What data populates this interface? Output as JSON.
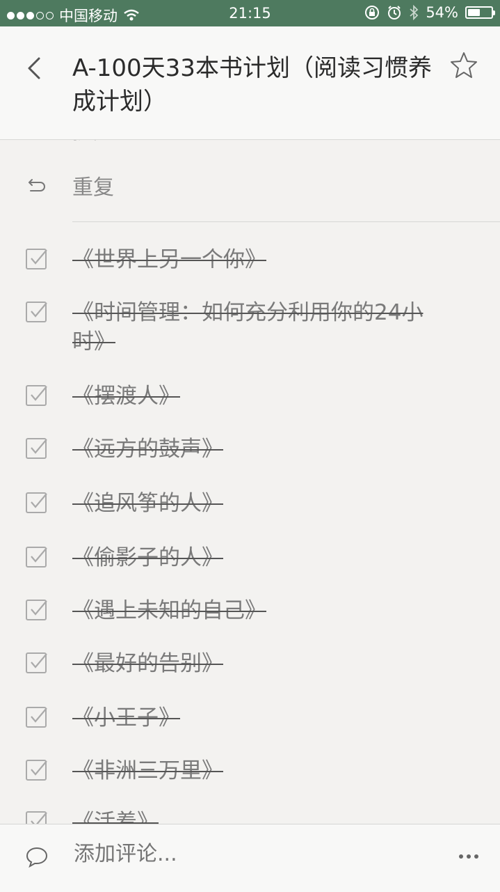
{
  "status_bar": {
    "carrier": "中国移动",
    "time": "21:15",
    "battery_percent": "54%",
    "battery_level": 0.54,
    "signal_bars": 3,
    "icons": [
      "wifi-icon",
      "rotation-lock-icon",
      "alarm-icon",
      "bluetooth-icon",
      "battery-icon"
    ]
  },
  "header": {
    "title": "A-100天33本书计划（阅读习惯养成计划）",
    "back_icon": "chevron-left-icon",
    "star_icon": "star-outline-icon"
  },
  "details": {
    "partial_label": "提醒",
    "repeat_label": "重复",
    "repeat_icon": "repeat-icon"
  },
  "checklist": [
    {
      "title": "《世界上另一个你》",
      "done": true
    },
    {
      "title": "《时间管理：如何充分利用你的24小时》",
      "done": true
    },
    {
      "title": "《摆渡人》",
      "done": true
    },
    {
      "title": "《远方的鼓声》",
      "done": true
    },
    {
      "title": "《追风筝的人》",
      "done": true
    },
    {
      "title": "《偷影子的人》",
      "done": true
    },
    {
      "title": "《遇上未知的自己》",
      "done": true
    },
    {
      "title": "《最好的告别》",
      "done": true
    },
    {
      "title": "《小王子》",
      "done": true
    },
    {
      "title": "《非洲三万里》",
      "done": true
    },
    {
      "title": "《活着》",
      "done": true
    }
  ],
  "comment_bar": {
    "placeholder": "添加评论...",
    "comment_icon": "speech-bubble-icon",
    "more_icon": "ellipsis-icon"
  },
  "colors": {
    "status_bar": "#4e7a5f",
    "background": "#f3f2f0",
    "text_done": "#7a7a7a"
  }
}
